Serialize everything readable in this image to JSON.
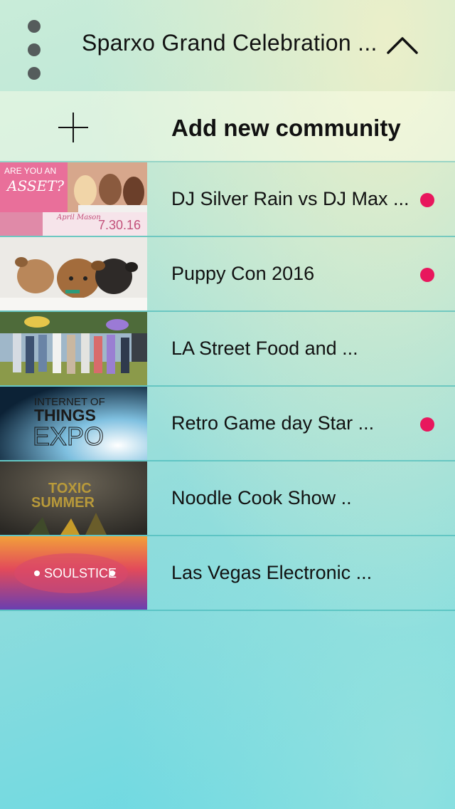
{
  "header": {
    "title": "Sparxo Grand Celebration ...",
    "menu_icon": "more-vertical-icon",
    "chevron_icon": "chevron-up-icon"
  },
  "add_community": {
    "label": "Add new community",
    "icon": "plus-icon"
  },
  "communities": [
    {
      "label": "DJ Silver Rain vs DJ Max ...",
      "has_notification": true,
      "thumb": "promo-flyer"
    },
    {
      "label": "Puppy Con 2016",
      "has_notification": true,
      "thumb": "puppies"
    },
    {
      "label": "LA Street Food and ...",
      "has_notification": false,
      "thumb": "crowd"
    },
    {
      "label": "Retro Game day Star ...",
      "has_notification": true,
      "thumb": "iot-expo"
    },
    {
      "label": "Noodle Cook Show ..",
      "has_notification": false,
      "thumb": "toxic-summer"
    },
    {
      "label": "Las Vegas Electronic ...",
      "has_notification": false,
      "thumb": "soulstice"
    }
  ],
  "thumb_text": {
    "flyer_line1": "ARE YOU AN",
    "flyer_line2": "ASSET?",
    "flyer_date": "7.30.16",
    "flyer_name": "April Mason",
    "iot_line1": "INTERNET OF",
    "iot_line2": "THINGS",
    "iot_line3": "EXPO",
    "toxic_line1": "TOXIC",
    "toxic_line2": "SUMMER",
    "soul": "SOULSTICE"
  },
  "colors": {
    "badge": "#e8175d",
    "menu_dots": "#555c5c"
  }
}
